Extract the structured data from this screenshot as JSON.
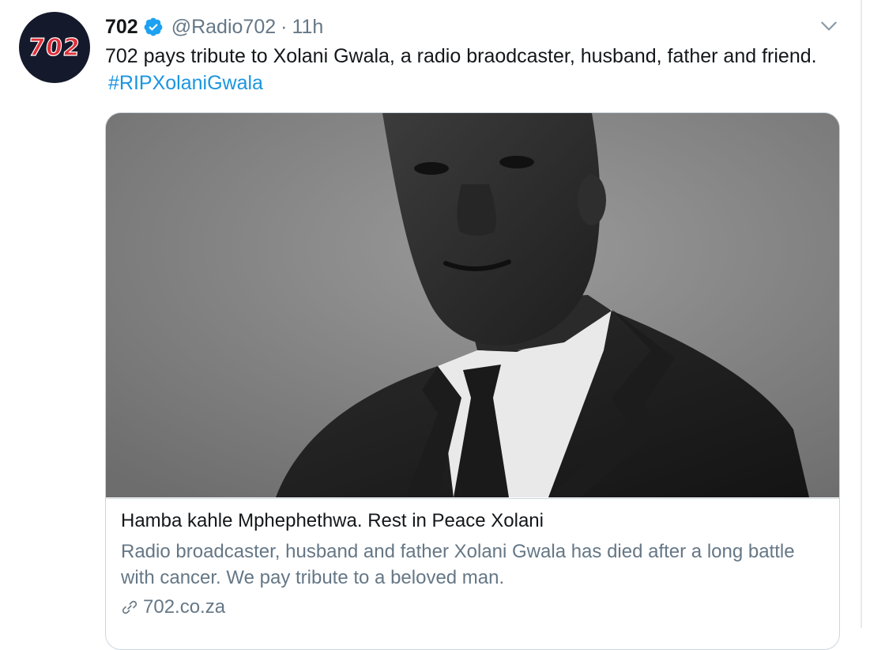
{
  "tweet": {
    "avatar_text": "702",
    "display_name": "702",
    "handle": "@Radio702",
    "separator": "·",
    "time": "11h",
    "text": "702 pays tribute to Xolani Gwala, a radio braodcaster, husband, father and friend.",
    "hashtag": "#RIPXolaniGwala"
  },
  "card": {
    "title": "Hamba kahle Mphephethwa. Rest in Peace Xolani",
    "description": "Radio broadcaster, husband and father Xolani Gwala has died after a long battle with cancer. We pay tribute to a beloved man.",
    "domain": "702.co.za"
  },
  "colors": {
    "link": "#1b95e0",
    "secondary_text": "#657786",
    "verified": "#1da1f2",
    "avatar_bg": "#141a2b",
    "avatar_text": "#e0303a",
    "border": "#ccd6dd"
  },
  "icons": {
    "verified": "verified-badge-icon",
    "caret": "chevron-down-icon",
    "link": "link-icon"
  }
}
